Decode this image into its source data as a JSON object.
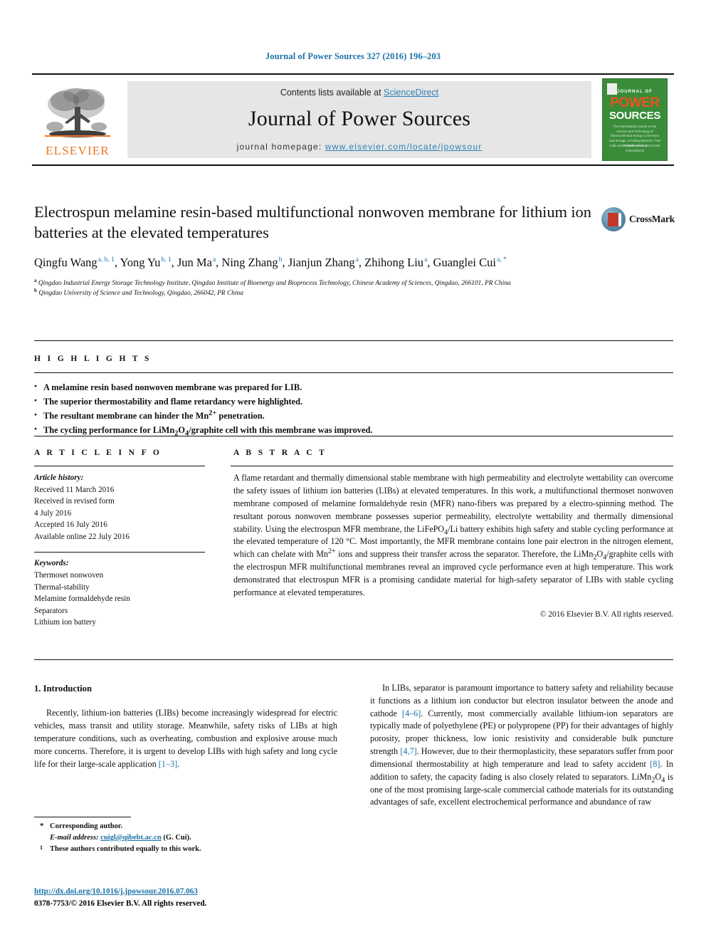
{
  "running_head": "Journal of Power Sources 327 (2016) 196–203",
  "masthead": {
    "publisher_name": "ELSEVIER",
    "contents_prefix": "Contents lists available at ",
    "contents_link": "ScienceDirect",
    "journal_title": "Journal of Power Sources",
    "homepage_prefix": "journal homepage: ",
    "homepage_url": "www.elsevier.com/locate/jpowsour",
    "cover": {
      "line_journal_of": "JOURNAL OF",
      "line_power": "POWER",
      "line_sources": "SOURCES",
      "subtitle": "The International Journal on the Science and Technology of Electrochemical Energy Conversion and Storage, including Batteries, Fuel Cells and Photoelectrochemical Cells",
      "footer": "Available online at\nScienceDirect"
    }
  },
  "article": {
    "title": "Electrospun melamine resin-based multifunctional nonwoven membrane for lithium ion batteries at the elevated temperatures",
    "authors": [
      {
        "name": "Qingfu Wang",
        "marks": "a, b, 1",
        "sep": ", "
      },
      {
        "name": "Yong Yu",
        "marks": "b, 1",
        "sep": ", "
      },
      {
        "name": "Jun Ma",
        "marks": "a",
        "sep": ", "
      },
      {
        "name": "Ning Zhang",
        "marks": "b",
        "sep": ", "
      },
      {
        "name": "Jianjun Zhang",
        "marks": "a",
        "sep": ", "
      },
      {
        "name": "Zhihong Liu",
        "marks": "a",
        "sep": ", "
      },
      {
        "name": "Guanglei Cui",
        "marks": "a, *",
        "sep": ""
      }
    ],
    "affiliations": [
      {
        "mark": "a",
        "text": "Qingdao Industrial Energy Storage Technology Institute, Qingdao Institute of Bioenergy and Bioprocess Technology, Chinese Academy of Sciences, Qingdao, 266101, PR China"
      },
      {
        "mark": "b",
        "text": "Qingdao University of Science and Technology, Qingdao, 266042, PR China"
      }
    ],
    "crossmark_label": "CrossMark"
  },
  "highlights": {
    "heading": "H I G H L I G H T S",
    "items": [
      "A melamine resin based nonwoven membrane was prepared for LIB.",
      "The superior thermostability and flame retardancy were highlighted.",
      "The resultant membrane can hinder the Mn2+ penetration.",
      "The cycling performance for LiMn2O4/graphite cell with this membrane was improved."
    ]
  },
  "article_info": {
    "heading": "A R T I C L E   I N F O",
    "history_label": "Article history:",
    "history": [
      "Received 11 March 2016",
      "Received in revised form",
      "4 July 2016",
      "Accepted 16 July 2016",
      "Available online 22 July 2016"
    ],
    "keywords_label": "Keywords:",
    "keywords": [
      "Thermoset nonwoven",
      "Thermal-stability",
      "Melamine formaldehyde resin",
      "Separators",
      "Lithium ion battery"
    ]
  },
  "abstract": {
    "heading": "A B S T R A C T",
    "text": "A flame retardant and thermally dimensional stable membrane with high permeability and electrolyte wettability can overcome the safety issues of lithium ion batteries (LIBs) at elevated temperatures. In this work, a multifunctional thermoset nonwoven membrane composed of melamine formaldehyde resin (MFR) nano-fibers was prepared by a electro-spinning method. The resultant porous nonwoven membrane possesses superior permeability, electrolyte wettability and thermally dimensional stability. Using the electrospun MFR membrane, the LiFePO4/Li battery exhibits high safety and stable cycling performance at the elevated temperature of 120 °C. Most importantly, the MFR membrane contains lone pair electron in the nitrogen element, which can chelate with Mn2+ ions and suppress their transfer across the separator. Therefore, the LiMn2O4/graphite cells with the electrospun MFR multifunctional membranes reveal an improved cycle performance even at high temperature. This work demonstrated that electrospun MFR is a promising candidate material for high-safety separator of LIBs with stable cycling performance at elevated temperatures.",
    "copyright": "© 2016 Elsevier B.V. All rights reserved."
  },
  "introduction": {
    "heading": "1. Introduction",
    "left_paragraph": "Recently, lithium-ion batteries (LIBs) become increasingly widespread for electric vehicles, mass transit and utility storage. Meanwhile, safety risks of LIBs at high temperature conditions, such as overheating, combustion and explosive arouse much more concerns. Therefore, it is urgent to develop LIBs with high safety and long cycle life for their large-scale application [1–3].",
    "right_paragraph": "In LIBs, separator is paramount importance to battery safety and reliability because it functions as a lithium ion conductor but electron insulator between the anode and cathode [4–6]. Currently, most commercially available lithium-ion separators are typically made of polyethylene (PE) or polypropene (PP) for their advantages of highly porosity, proper thickness, low ionic resistivity and considerable bulk puncture strength [4,7]. However, due to their thermoplasticity, these separators suffer from poor dimensional thermostability at high temperature and lead to safety accident [8]. In addition to safety, the capacity fading is also closely related to separators. LiMn2O4 is one of the most promising large-scale commercial cathode materials for its outstanding advantages of safe, excellent electrochemical performance and abundance of raw"
  },
  "footnotes": {
    "corresponding_mark": "*",
    "corresponding_text": "Corresponding author.",
    "email_label": "E-mail address:",
    "email": "cuigl@qibebt.ac.cn",
    "email_suffix": "(G. Cui).",
    "equal_mark": "1",
    "equal_text": "These authors contributed equally to this work."
  },
  "doi": {
    "url": "http://dx.doi.org/10.1016/j.jpowsour.2016.07.063",
    "issn_line": "0378-7753/© 2016 Elsevier B.V. All rights reserved."
  },
  "colors": {
    "link_blue": "#1a72a8",
    "masthead_gray": "#e6e6e6",
    "elsevier_orange": "#E87722",
    "cover_green": "#3a8c3a",
    "cover_orange": "#E8541E"
  }
}
